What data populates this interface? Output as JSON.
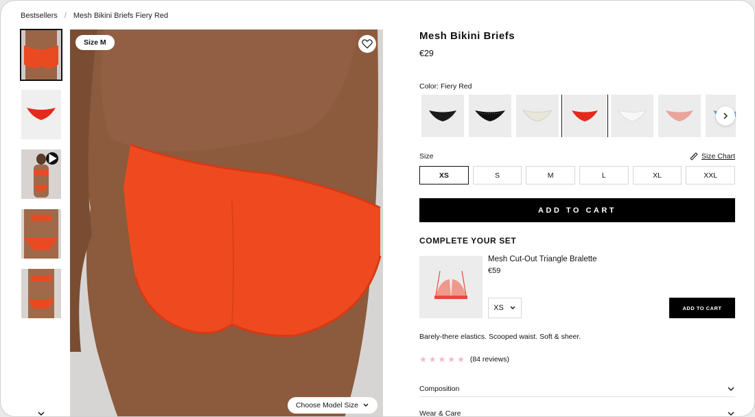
{
  "breadcrumb": {
    "root": "Bestsellers",
    "separator": "/",
    "current": "Mesh Bikini Briefs Fiery Red"
  },
  "gallery": {
    "size_pill": "Size M",
    "model_size_button": "Choose Model Size"
  },
  "product": {
    "title": "Mesh Bikini Briefs",
    "price": "€29",
    "color_label": "Color:",
    "color_value": "Fiery Red",
    "swatches": [
      {
        "name": "black mesh",
        "color": "#1a1a1a"
      },
      {
        "name": "black crystal",
        "color": "#111111"
      },
      {
        "name": "ivory crystal",
        "color": "#e9e6da"
      },
      {
        "name": "fiery red",
        "color": "#e32a1c"
      },
      {
        "name": "white",
        "color": "#f4f4f4"
      },
      {
        "name": "blush crystal",
        "color": "#e9a49b"
      },
      {
        "name": "blue",
        "color": "#5a9be0"
      }
    ],
    "size_label": "Size",
    "size_chart": "Size Chart",
    "sizes": [
      "XS",
      "S",
      "M",
      "L",
      "XL",
      "XXL"
    ],
    "selected_size": "XS",
    "add_to_cart": "ADD TO CART"
  },
  "set": {
    "heading": "COMPLETE YOUR SET",
    "name": "Mesh Cut-Out Triangle Bralette",
    "price": "€59",
    "size": "XS",
    "add_to_cart": "ADD TO CART"
  },
  "description": "Barely-there elastics. Scooped waist. Soft & sheer.",
  "rating": {
    "stars": 4.5,
    "reviews": "(84 reviews)"
  },
  "accordions": [
    "Composition",
    "Wear & Care"
  ],
  "colors": {
    "accent_red": "#e8431f",
    "star": "#f3b8c6",
    "black": "#000000"
  }
}
